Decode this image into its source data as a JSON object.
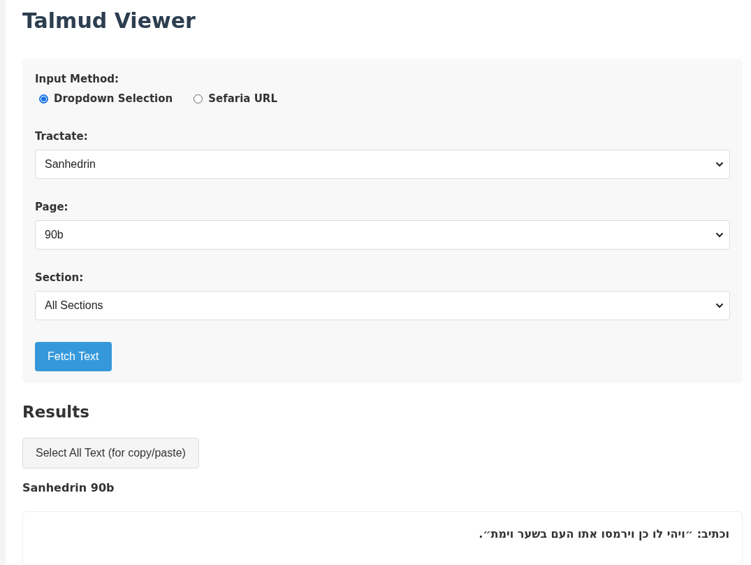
{
  "title": "Talmud Viewer",
  "form": {
    "input_method_label": "Input Method:",
    "methods": [
      {
        "label": "Dropdown Selection",
        "selected": true
      },
      {
        "label": "Sefaria URL",
        "selected": false
      }
    ],
    "selects": [
      {
        "label": "Tractate:",
        "value": "Sanhedrin"
      },
      {
        "label": "Page:",
        "value": "90b"
      },
      {
        "label": "Section:",
        "value": "All Sections"
      }
    ],
    "submit": "Fetch Text"
  },
  "results": {
    "heading": "Results",
    "select_all": "Select All Text (for copy/paste)",
    "source": "Sanhedrin 90b",
    "passages": [
      "וכתיב: ״ויהי לו כן וירמסו אתו העם בשער וימת״."
    ]
  }
}
